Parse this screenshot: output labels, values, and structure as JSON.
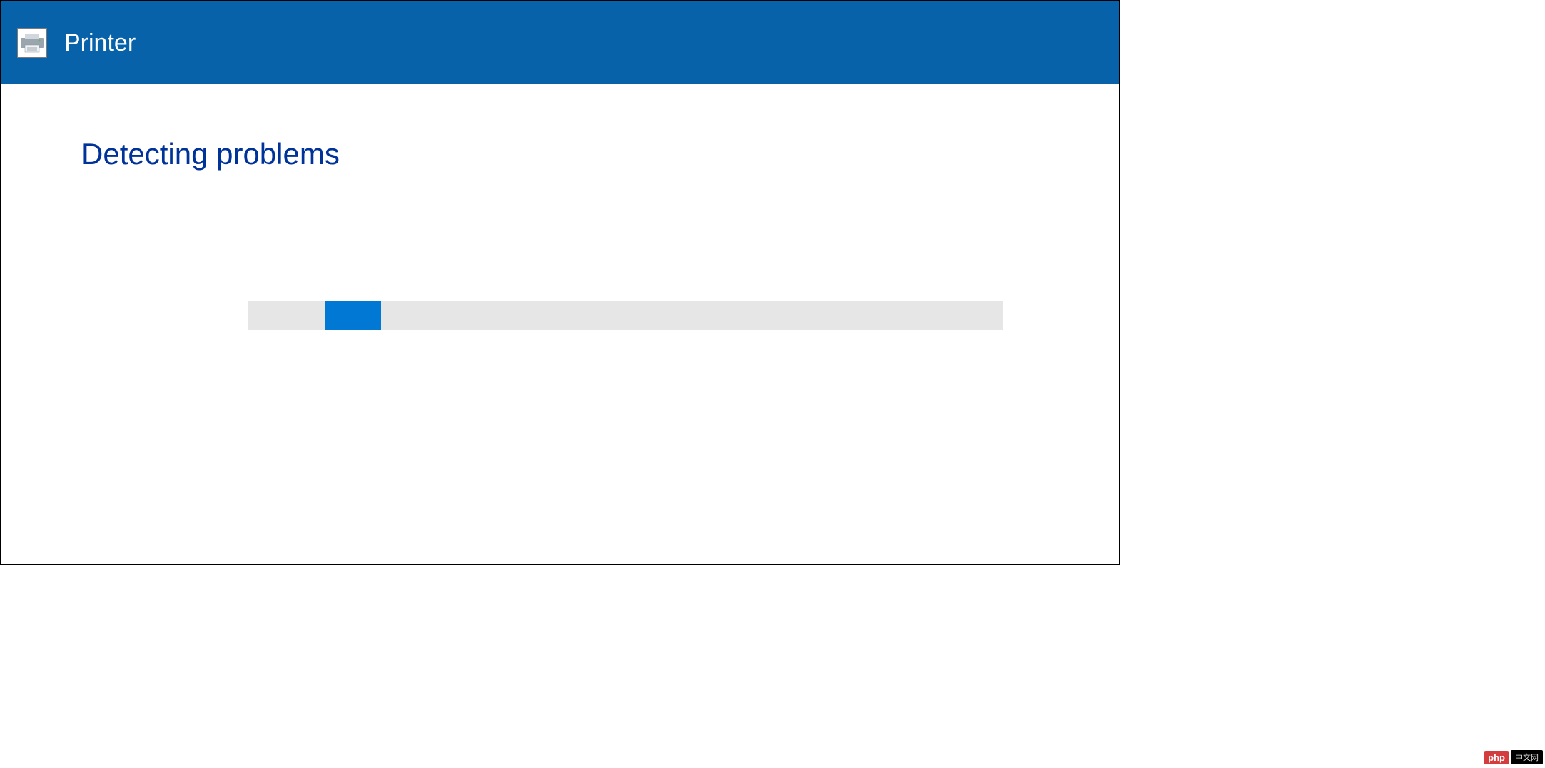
{
  "window": {
    "title": "Printer",
    "icon_name": "printer-icon"
  },
  "content": {
    "heading": "Detecting problems",
    "progress": {
      "track_color": "#e6e6e6",
      "indicator_color": "#0078d4",
      "indicator_position_percent": 10,
      "indicator_width_percent": 7
    }
  },
  "watermark": {
    "badge": "php",
    "text": "中文网"
  },
  "colors": {
    "titlebar_bg": "#0762a9",
    "heading_color": "#003399",
    "progress_indicator": "#0078d4"
  }
}
